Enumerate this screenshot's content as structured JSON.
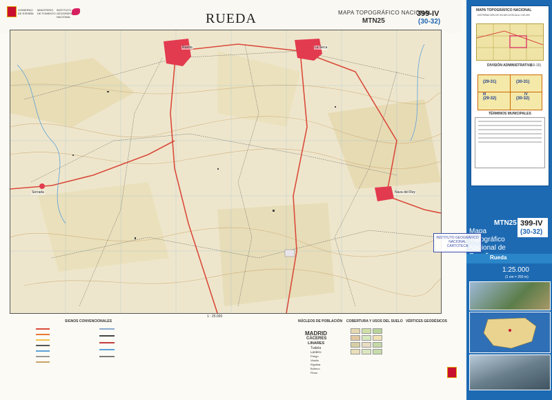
{
  "header": {
    "institution_lines": [
      "GOBIERNO",
      "DE ESPAÑA"
    ],
    "ministry_lines": [
      "MINISTERIO",
      "DE FOMENTO"
    ],
    "ign_lines": [
      "INSTITUTO",
      "GEOGRÁFICO",
      "NACIONAL"
    ],
    "title": "RUEDA",
    "series": "MAPA TOPOGRÁFICO NACIONAL",
    "series_code": "MTN25",
    "sheet_number": "399-IV",
    "sheet_grid": "(30-32)"
  },
  "map": {
    "towns": [
      {
        "name": "Rueda"
      },
      {
        "name": "La Seca"
      },
      {
        "name": "Nava del Rey"
      },
      {
        "name": "Serrada"
      }
    ],
    "scale_label": "1 : 25.000",
    "colors": {
      "terrain": "#eee6cc",
      "fields": "#e6d9b0",
      "roads": "#d94a3a",
      "water": "#5aa0d8",
      "towns": "#e23b4f"
    }
  },
  "legend": {
    "signos_title": "SIGNOS CONVENCIONALES",
    "nucleos_title": "NÚCLEOS DE POBLACIÓN",
    "cubierta_title": "COBERTURA Y USOS DEL SUELO",
    "vertices_title": "VÉRTICES GEODÉSICOS",
    "nucleos_names": [
      "MADRID",
      "CÁCERES",
      "LINARES",
      "Tudela",
      "Lardero",
      "Priego",
      "Vianllo",
      "Elgoibar",
      "Buñeco",
      "Pinos"
    ]
  },
  "cover": {
    "index_title": "MAPA TOPOGRÁFICO NACIONAL",
    "index_subtitle": "DISTRIBUCIÓN DE HOJAS A ESCALA 1:50.000",
    "admin_title": "DIVISIÓN ADMINISTRATIVA",
    "admin_code": "(15-15)",
    "grid_cells": [
      "(29-31)",
      "(30-31)",
      "(29-32)",
      "(30-32)"
    ],
    "grid_labels": [
      "III",
      "IV"
    ],
    "municipios_title": "TÉRMINOS MUNICIPALES",
    "series_code": "MTN25",
    "sheet_number": "399-IV",
    "sheet_grid": "(30-32)",
    "cover_title_lines": [
      "Mapa",
      "Topográfico",
      "Nacional de España"
    ],
    "sheet_name": "Rueda",
    "stamp_lines": [
      "INSTITUTO GEOGRÁFICO",
      "NACIONAL",
      "CARTOTECA"
    ],
    "scale": "1:25.000",
    "scale_sub": "(1 cm = 250 m)"
  }
}
